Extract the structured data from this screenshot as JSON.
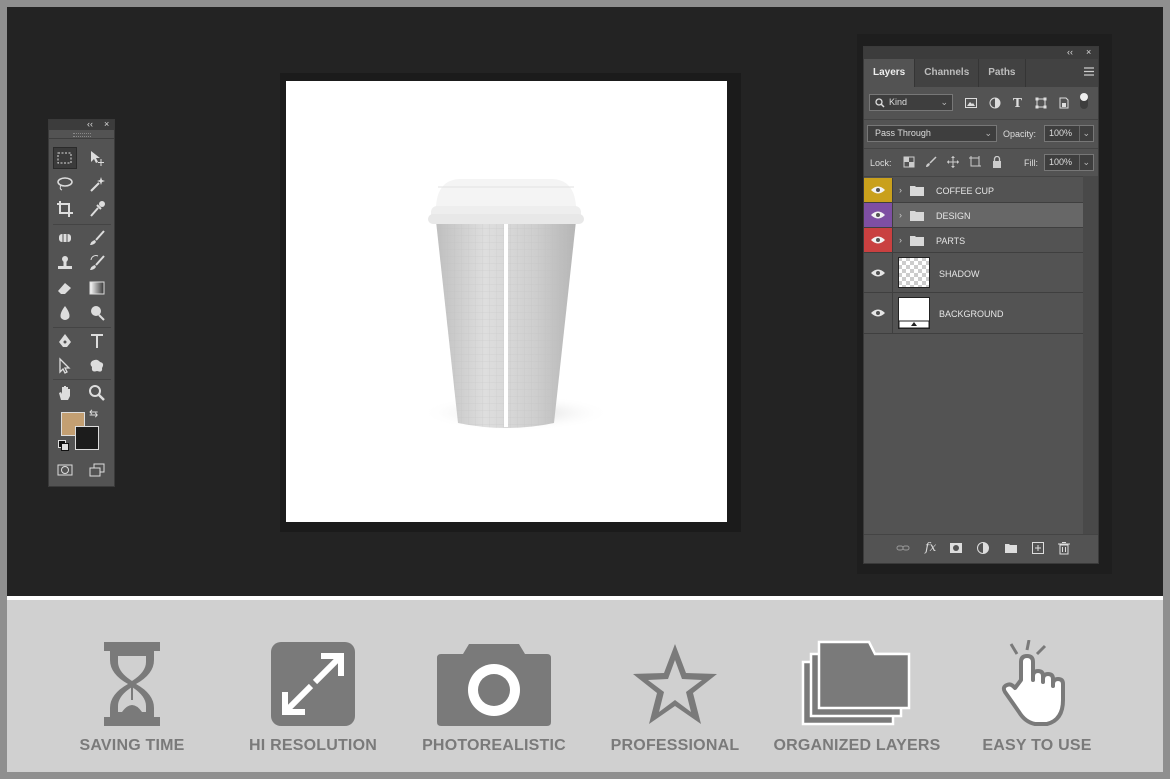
{
  "layers_panel": {
    "tabs": [
      "Layers",
      "Channels",
      "Paths"
    ],
    "filter_kind": "Kind",
    "blend_mode": "Pass Through",
    "opacity_label": "Opacity:",
    "opacity_value": "100%",
    "lock_label": "Lock:",
    "fill_label": "Fill:",
    "fill_value": "100%",
    "layers": [
      {
        "name": "COFFEE CUP",
        "type": "group",
        "color": "#c9a01c"
      },
      {
        "name": "DESIGN",
        "type": "group",
        "color": "#7e4fa3"
      },
      {
        "name": "PARTS",
        "type": "group",
        "color": "#c94040"
      },
      {
        "name": "SHADOW",
        "type": "layer",
        "color": ""
      },
      {
        "name": "BACKGROUND",
        "type": "layer",
        "color": ""
      }
    ]
  },
  "toolbox": {
    "foreground_color": "#c39f72",
    "background_color": "#1c1c1c",
    "tools": [
      "marquee-icon",
      "move-icon",
      "lasso-icon",
      "magic-wand-icon",
      "crop-icon",
      "eyedropper-icon",
      "healing-icon",
      "brush-icon",
      "stamp-icon",
      "history-brush-icon",
      "eraser-icon",
      "gradient-icon",
      "blur-icon",
      "dodge-icon",
      "pen-icon",
      "type-icon",
      "path-select-icon",
      "shape-icon",
      "hand-icon",
      "zoom-icon"
    ]
  },
  "features": [
    {
      "label": "SAVING TIME",
      "icon": "hourglass-icon"
    },
    {
      "label": "HI RESOLUTION",
      "icon": "expand-icon"
    },
    {
      "label": "PHOTOREALISTIC",
      "icon": "camera-icon"
    },
    {
      "label": "PROFESSIONAL",
      "icon": "star-icon"
    },
    {
      "label": "ORGANIZED LAYERS",
      "icon": "folders-icon"
    },
    {
      "label": "EASY TO USE",
      "icon": "tap-hand-icon"
    }
  ]
}
